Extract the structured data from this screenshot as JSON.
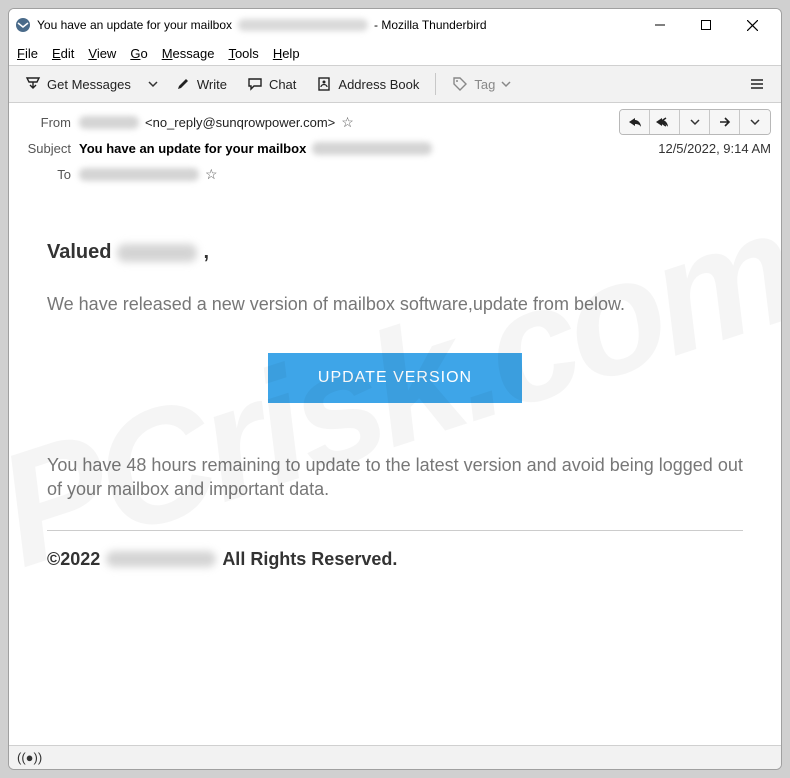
{
  "window": {
    "title_prefix": "You have an update for your mailbox",
    "title_suffix": "- Mozilla Thunderbird"
  },
  "menu": {
    "file": "File",
    "edit": "Edit",
    "view": "View",
    "go": "Go",
    "message": "Message",
    "tools": "Tools",
    "help": "Help"
  },
  "toolbar": {
    "get_messages": "Get Messages",
    "write": "Write",
    "chat": "Chat",
    "address_book": "Address Book",
    "tag": "Tag"
  },
  "headers": {
    "from_label": "From",
    "from_addr": "<no_reply@sunqrowpower.com>",
    "subject_label": "Subject",
    "subject_value": "You have an update for your mailbox",
    "to_label": "To",
    "datetime": "12/5/2022, 9:14 AM"
  },
  "mail": {
    "salutation_prefix": "Valued",
    "salutation_suffix": ",",
    "paragraph1": "We have released a new version of mailbox software,update from below.",
    "button": "UPDATE VERSION",
    "paragraph2": "You have 48 hours remaining to update to the latest version and avoid being logged out of your mailbox and important data.",
    "footer_prefix": "©2022",
    "footer_suffix": "All Rights Reserved."
  }
}
